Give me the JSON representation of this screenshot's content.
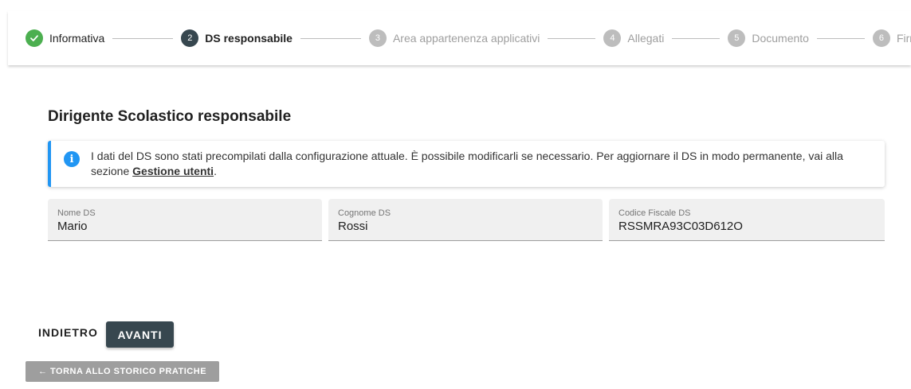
{
  "stepper": {
    "steps": [
      {
        "number": "",
        "label": "Informativa",
        "state": "done",
        "icon": "check-icon"
      },
      {
        "number": "2",
        "label": "DS responsabile",
        "state": "active"
      },
      {
        "number": "3",
        "label": "Area appartenenza applicativi",
        "state": "todo"
      },
      {
        "number": "4",
        "label": "Allegati",
        "state": "todo"
      },
      {
        "number": "5",
        "label": "Documento",
        "state": "todo"
      },
      {
        "number": "6",
        "label": "Firma",
        "state": "todo"
      }
    ]
  },
  "main": {
    "title": "Dirigente Scolastico responsabile",
    "alert": {
      "icon": "info-icon",
      "text": "I dati del DS sono stati precompilati dalla configurazione attuale. È possibile modificarli se necessario. Per aggiornare il DS in modo permanente, vai alla sezione ",
      "link": "Gestione utenti",
      "suffix": ".",
      "accent_color": "#2196f3"
    },
    "fields": {
      "nome": {
        "label": "Nome DS",
        "value": "Mario"
      },
      "cognome": {
        "label": "Cognome DS",
        "value": "Rossi"
      },
      "codice_fiscale": {
        "label": "Codice Fiscale DS",
        "value": "RSSMRA93C03D612O"
      }
    }
  },
  "actions": {
    "back_label": "INDIETRO",
    "next_label": "AVANTI",
    "history_label": "← TORNA ALLO STORICO PRATICHE"
  },
  "colors": {
    "primary": "#37474f",
    "success": "#4caf50",
    "inactive": "#bdbdbd"
  }
}
